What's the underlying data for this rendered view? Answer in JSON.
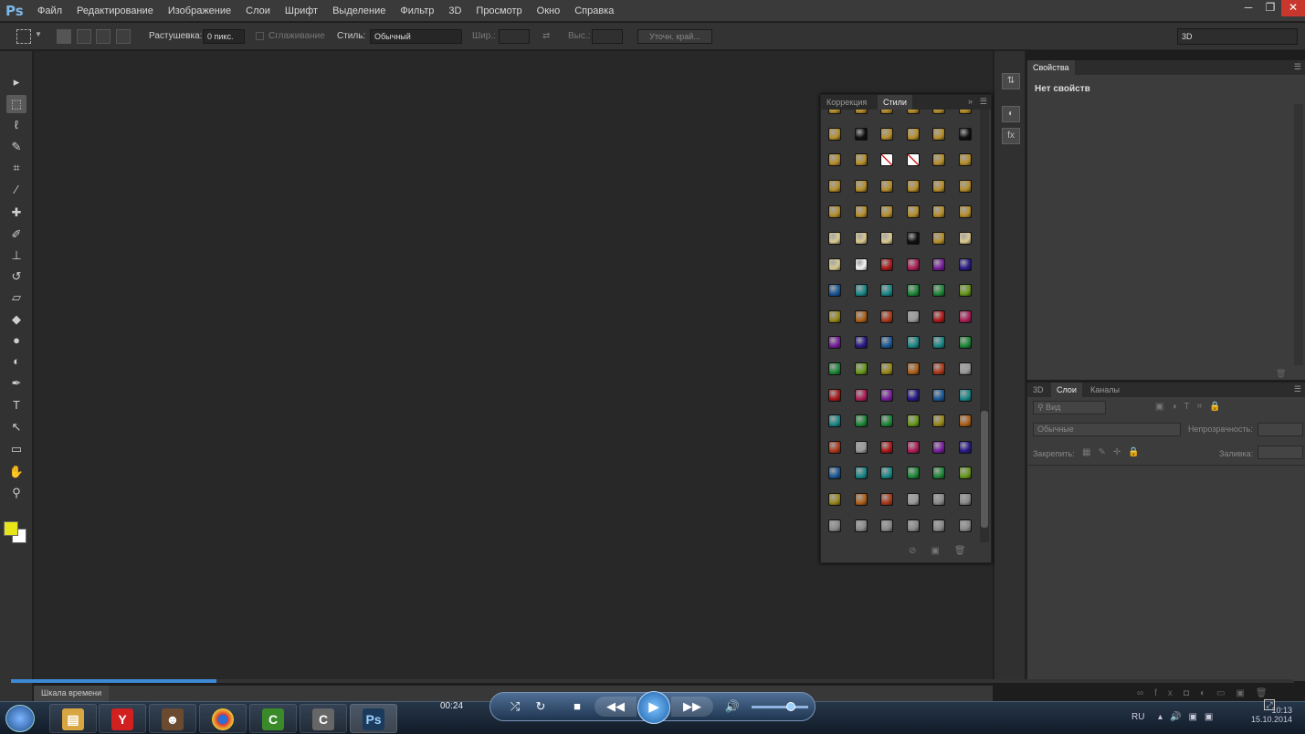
{
  "app": {
    "logo": "Ps"
  },
  "menu": [
    "Файл",
    "Редактирование",
    "Изображение",
    "Слои",
    "Шрифт",
    "Выделение",
    "Фильтр",
    "3D",
    "Просмотр",
    "Окно",
    "Справка"
  ],
  "window_controls": {
    "minimize": "─",
    "restore": "❐",
    "close": "✕"
  },
  "options": {
    "feather_label": "Растушевка:",
    "feather_value": "0 пикс.",
    "antialias_label": "Сглаживание",
    "style_label": "Стиль:",
    "style_value": "Обычный",
    "width_label": "Шир.:",
    "height_label": "Выс.:",
    "refine_button": "Уточн. край...",
    "workspace_value": "3D"
  },
  "tools": [
    {
      "name": "move-tool",
      "glyph": "▸"
    },
    {
      "name": "marquee-tool",
      "glyph": "⬚"
    },
    {
      "name": "lasso-tool",
      "glyph": "ℓ"
    },
    {
      "name": "quick-select-tool",
      "glyph": "✎"
    },
    {
      "name": "crop-tool",
      "glyph": "⌗"
    },
    {
      "name": "eyedropper-tool",
      "glyph": "⁄"
    },
    {
      "name": "healing-tool",
      "glyph": "✚"
    },
    {
      "name": "brush-tool",
      "glyph": "✐"
    },
    {
      "name": "stamp-tool",
      "glyph": "⊥"
    },
    {
      "name": "history-brush-tool",
      "glyph": "↺"
    },
    {
      "name": "eraser-tool",
      "glyph": "▱"
    },
    {
      "name": "paint-bucket-tool",
      "glyph": "◆"
    },
    {
      "name": "blur-tool",
      "glyph": "●"
    },
    {
      "name": "dodge-tool",
      "glyph": "◐"
    },
    {
      "name": "pen-tool",
      "glyph": "✒"
    },
    {
      "name": "type-tool",
      "glyph": "T"
    },
    {
      "name": "path-select-tool",
      "glyph": "↖"
    },
    {
      "name": "shape-tool",
      "glyph": "▭"
    },
    {
      "name": "hand-tool",
      "glyph": "✋"
    },
    {
      "name": "zoom-tool",
      "glyph": "⚲"
    }
  ],
  "colors": {
    "foreground": "#e8e41a",
    "background": "#ffffff",
    "accent": "#3c8ad6"
  },
  "styles_panel": {
    "tab_corrections": "Коррекция",
    "tab_styles": "Стили",
    "palette": [
      [
        "gold",
        "gold",
        "gold",
        "gold",
        "gold",
        "gold"
      ],
      [
        "gold",
        "black",
        "gold",
        "gold",
        "gold",
        "black"
      ],
      [
        "gold",
        "gold",
        "none",
        "none",
        "gold",
        "gold"
      ],
      [
        "gold",
        "gold",
        "gold",
        "gold",
        "gold",
        "gold"
      ],
      [
        "gold",
        "gold",
        "gold",
        "gold",
        "gold",
        "gold"
      ],
      [
        "cream",
        "cream",
        "cream",
        "black",
        "gold",
        "cream"
      ],
      [
        "cream",
        "white",
        "red",
        "magenta",
        "purple",
        "indigo"
      ],
      [
        "blue",
        "teal",
        "teal",
        "green",
        "green",
        "lime"
      ],
      [
        "olive",
        "orange",
        "redorange",
        "silver",
        "red",
        "magenta"
      ],
      [
        "purple",
        "indigo",
        "blue",
        "teal",
        "teal",
        "green"
      ],
      [
        "green",
        "lime",
        "olive",
        "orange",
        "redorange",
        "silver"
      ],
      [
        "red",
        "magenta",
        "purple",
        "indigo",
        "blue",
        "teal"
      ],
      [
        "teal",
        "green",
        "green",
        "lime",
        "olive",
        "orange"
      ],
      [
        "redorange",
        "silver",
        "red",
        "magenta",
        "purple",
        "indigo"
      ],
      [
        "blue",
        "teal",
        "teal",
        "green",
        "green",
        "lime"
      ],
      [
        "olive",
        "orange",
        "redorange",
        "silver",
        "gray",
        "gray"
      ],
      [
        "gray",
        "gray",
        "gray",
        "gray",
        "gray",
        "gray"
      ]
    ],
    "swatch_colors": {
      "gold": "#b8902c",
      "black": "#111111",
      "none": "#ffffff",
      "cream": "#d8c890",
      "white": "#f4f4f4",
      "red": "#b01a1a",
      "magenta": "#b0205a",
      "purple": "#7a1fa0",
      "indigo": "#2a1c8a",
      "blue": "#1c5a9a",
      "teal": "#1c8a8a",
      "green": "#1f8a3a",
      "lime": "#6a9a1c",
      "olive": "#9a8a1c",
      "orange": "#b0621c",
      "redorange": "#b03a1c",
      "silver": "#9a9a9a",
      "gray": "#8a8a8a"
    }
  },
  "properties_panel": {
    "tab": "Свойства",
    "empty_text": "Нет свойств"
  },
  "layers_panel": {
    "tab_3d": "3D",
    "tab_layers": "Слои",
    "tab_channels": "Каналы",
    "filter_placeholder": "Вид",
    "blend_mode": "Обычные",
    "opacity_label": "Непрозрачность:",
    "lock_label": "Закрепить:",
    "fill_label": "Заливка:"
  },
  "timeline": {
    "label": "Шкала времени"
  },
  "player": {
    "time": "00:24",
    "progress": 0.16
  },
  "taskbar": {
    "lang": "RU",
    "clock_time": "10:13",
    "clock_date": "15.10.2014"
  }
}
